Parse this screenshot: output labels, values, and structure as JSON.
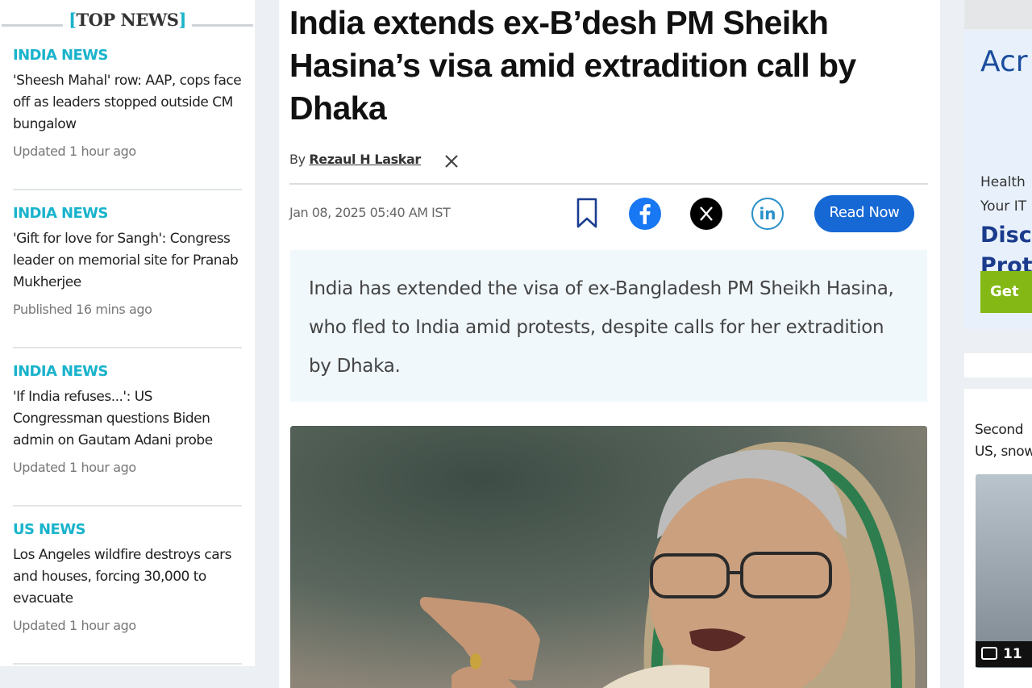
{
  "sidebar": {
    "title": "TOP NEWS",
    "bracket_left": "[",
    "bracket_right": "]",
    "items": [
      {
        "category": "INDIA NEWS",
        "headline": "'Sheesh Mahal' row: AAP, cops face off as leaders stopped outside CM bungalow",
        "time": "Updated 1 hour ago"
      },
      {
        "category": "INDIA NEWS",
        "headline": "'Gift for love for Sangh': Congress leader on memorial site for Pranab Mukherjee",
        "time": "Published 16 mins ago"
      },
      {
        "category": "INDIA NEWS",
        "headline": "'If India refuses...': US Congressman questions Biden admin on Gautam Adani probe",
        "time": "Updated 1 hour ago"
      },
      {
        "category": "US NEWS",
        "headline": "Los Angeles wildfire destroys cars and houses, forcing 30,000 to evacuate",
        "time": "Updated 1 hour ago"
      }
    ]
  },
  "article": {
    "headline": "India extends ex-B’desh PM Sheikh Hasina’s visa amid extradition call by Dhaka",
    "by_prefix": "By",
    "author": "Rezaul H Laskar",
    "date": "Jan 08, 2025 05:40 AM IST",
    "read_now": "Read Now",
    "summary": "India has extended the visa of ex-Bangladesh PM Sheikh Hasina, who fled to India amid protests, despite calls for her extradition by Dhaka."
  },
  "right_ad": {
    "brand": "Acr",
    "line1": "Health",
    "line2": "Your IT",
    "big1": "Disc",
    "big2": "Prot",
    "button": "Get"
  },
  "right_card": {
    "line1": "Second",
    "line2": "US, snow",
    "photo_count": "11"
  },
  "colors": {
    "category": "#19b3cc",
    "read_now_bg": "#1668d4",
    "facebook": "#1877f2",
    "linkedin": "#2a90c9"
  }
}
